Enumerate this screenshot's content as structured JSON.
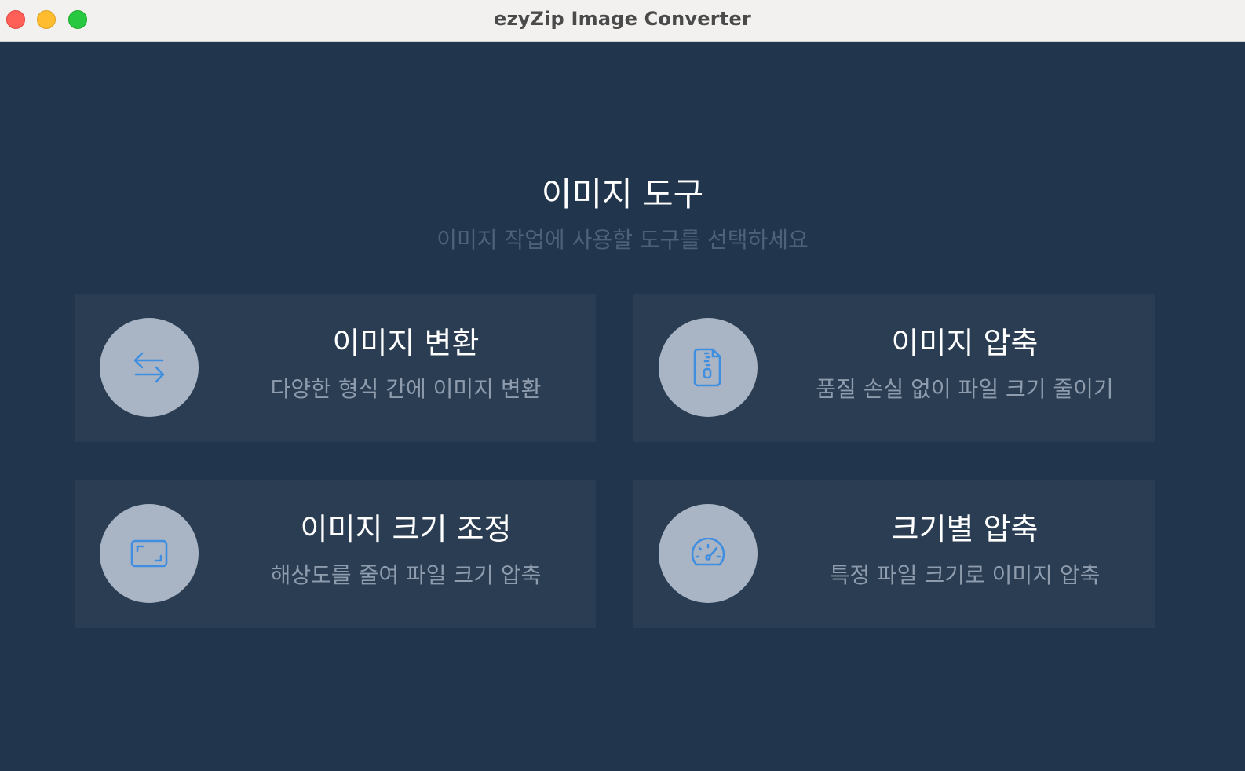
{
  "window": {
    "title": "ezyZip Image Converter"
  },
  "main": {
    "heading": "이미지 도구",
    "subheading": "이미지 작업에 사용할 도구를 선택하세요"
  },
  "tools": [
    {
      "title": "이미지 변환",
      "description": "다양한 형식 간에 이미지 변환",
      "icon": "convert-arrows-icon"
    },
    {
      "title": "이미지 압축",
      "description": "품질 손실 없이 파일 크기 줄이기",
      "icon": "zip-file-icon"
    },
    {
      "title": "이미지 크기 조정",
      "description": "해상도를 줄여 파일 크기 압축",
      "icon": "resize-frame-icon"
    },
    {
      "title": "크기별 압축",
      "description": "특정 파일 크기로 이미지 압축",
      "icon": "gauge-icon"
    }
  ],
  "colors": {
    "background": "#21354c",
    "card": "#2a3d52",
    "icon_circle": "#a9b5c5",
    "icon_accent": "#3f8ee0",
    "title_text": "#ffffff",
    "muted_text": "#8e9cad"
  }
}
